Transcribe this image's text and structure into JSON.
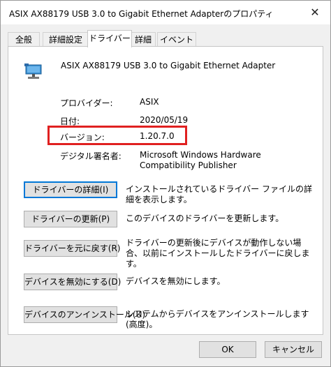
{
  "window": {
    "title": "ASIX AX88179 USB 3.0 to Gigabit Ethernet Adapterのプロパティ",
    "close_glyph": "✕"
  },
  "tabs": [
    {
      "label": "全般"
    },
    {
      "label": "詳細設定"
    },
    {
      "label": "ドライバー"
    },
    {
      "label": "詳細"
    },
    {
      "label": "イベント"
    }
  ],
  "device": {
    "name": "ASIX AX88179 USB 3.0 to Gigabit Ethernet Adapter",
    "icon": "network-adapter-icon"
  },
  "properties": {
    "provider_label": "プロバイダー:",
    "provider_value": "ASIX",
    "date_label": "日付:",
    "date_value": "2020/05/19",
    "version_label": "バージョン:",
    "version_value": "1.20.7.0",
    "signer_label": "デジタル署名者:",
    "signer_value": "Microsoft Windows Hardware Compatibility Publisher"
  },
  "actions": [
    {
      "label": "ドライバーの詳細(I)",
      "desc": "インストールされているドライバー ファイルの詳細を表示します。"
    },
    {
      "label": "ドライバーの更新(P)",
      "desc": "このデバイスのドライバーを更新します。"
    },
    {
      "label": "ドライバーを元に戻す(R)",
      "desc": "ドライバーの更新後にデバイスが動作しない場合、以前にインストールしたドライバーに戻します。"
    },
    {
      "label": "デバイスを無効にする(D)",
      "desc": "デバイスを無効にします。"
    },
    {
      "label": "デバイスのアンインストール(U)",
      "desc": "システムからデバイスをアンインストールします (高度)。"
    }
  ],
  "footer": {
    "ok_label": "OK",
    "cancel_label": "キャンセル"
  },
  "colors": {
    "highlight": "#e02020",
    "focus": "#0078d7"
  }
}
